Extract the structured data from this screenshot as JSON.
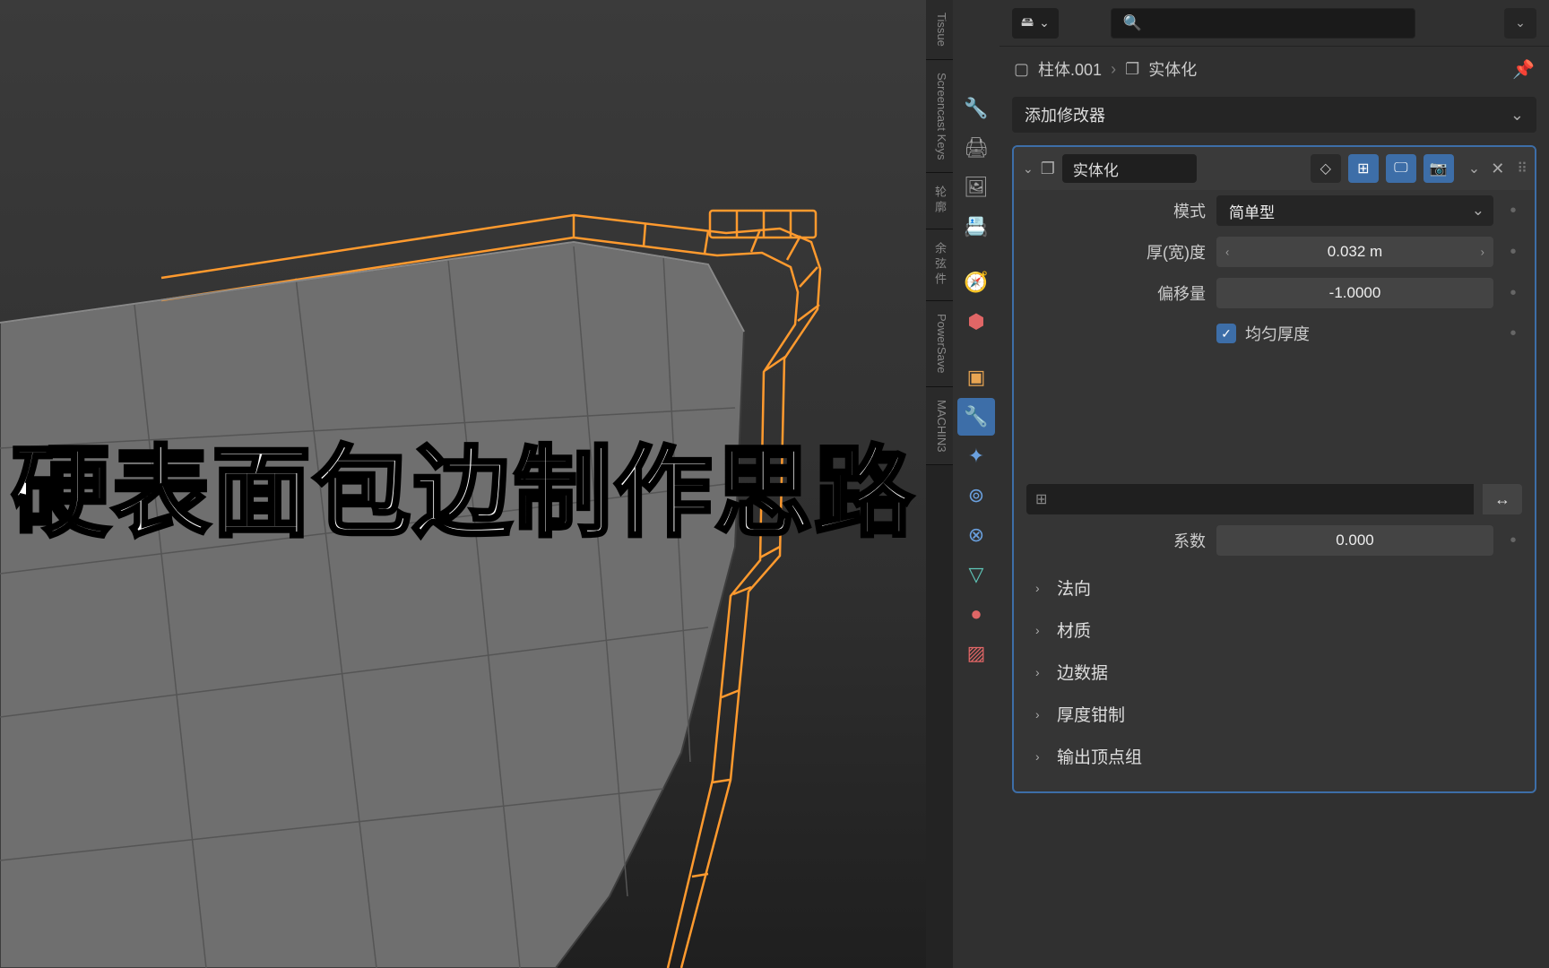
{
  "viewport": {
    "title_overlay": "硬表面包边制作思路"
  },
  "side_tabs": [
    "Tissue",
    "Screencast Keys",
    "轮廓",
    "余弦件",
    "PowerSave",
    "MACHIN3"
  ],
  "prop_icons": [
    {
      "name": "render-icon",
      "glyph": "🖵"
    },
    {
      "name": "output-icon",
      "glyph": "🖨"
    },
    {
      "name": "viewlayer-icon",
      "glyph": "🖼"
    },
    {
      "name": "scene-icon",
      "glyph": "🌐"
    },
    {
      "name": "world-icon",
      "glyph": "🧭"
    },
    {
      "name": "collection-icon",
      "glyph": "🗂"
    },
    {
      "name": "sep",
      "glyph": ""
    },
    {
      "name": "object-icon",
      "glyph": "📦"
    },
    {
      "name": "modifier-icon",
      "glyph": "🔧",
      "active": true
    },
    {
      "name": "particle-icon",
      "glyph": "✨"
    },
    {
      "name": "physics-icon",
      "glyph": "⚛"
    },
    {
      "name": "constraint-icon",
      "glyph": "🔗"
    },
    {
      "name": "mesh-icon",
      "glyph": "▽"
    },
    {
      "name": "material-icon",
      "glyph": "●"
    },
    {
      "name": "texture-icon",
      "glyph": "▨"
    }
  ],
  "header": {
    "dropdown_glyph": "🖴"
  },
  "breadcrumb": {
    "object_icon": "▢",
    "object_name": "柱体.001",
    "modifier_icon": "❐",
    "modifier_name": "实体化"
  },
  "add_modifier_label": "添加修改器",
  "modifier": {
    "name": "实体化",
    "mode_label": "模式",
    "mode_value": "简单型",
    "thickness_label": "厚(宽)度",
    "thickness_value": "0.032 m",
    "offset_label": "偏移量",
    "offset_value": "-1.0000",
    "even_label": "均匀厚度",
    "even_checked": true,
    "factor_label": "系数",
    "factor_value": "0.000",
    "sub_sections": [
      "法向",
      "材质",
      "边数据",
      "厚度钳制",
      "输出顶点组"
    ]
  }
}
